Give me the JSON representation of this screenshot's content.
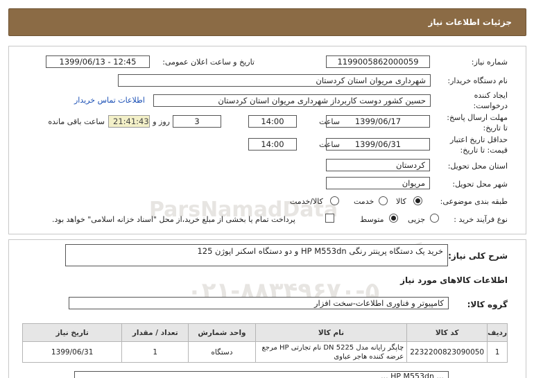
{
  "header": {
    "title": "جزئیات اطلاعات نیاز"
  },
  "labels": {
    "need_number": "شماره نیاز:",
    "announce_datetime": "تاریخ و ساعت اعلان عمومی:",
    "buyer_org": "نام دستگاه خریدار:",
    "requester_line1": "ایجاد کننده",
    "requester_line2": "درخواست:",
    "buyer_contact": "اطلاعات تماس خریدار",
    "deadline_line1": "مهلت ارسال پاسخ:",
    "deadline_line2": "تا تاریخ:",
    "time": "ساعت",
    "days_and": "روز و",
    "remaining": "ساعت باقی مانده",
    "validity_line1": "حداقل تاریخ اعتبار",
    "validity_line2": "قیمت: تا تاریخ:",
    "province": "استان محل تحویل:",
    "city": "شهر محل تحویل:",
    "category": "طبقه بندی موضوعی:",
    "process": "نوع فرآیند خرید :",
    "description": "شرح کلی نیاز:",
    "goods_info": "اطلاعات کالاهای مورد نیاز",
    "goods_group": "گروه کالا:"
  },
  "fields": {
    "need_number": "1199005862000059",
    "announce_datetime": "1399/06/13 - 12:45",
    "buyer_org": "شهرداری مریوان استان کردستان",
    "requester": "حسین کشور دوست کاربرداز شهرداری مریوان استان کردستان",
    "deadline_date": "1399/06/17",
    "deadline_time": "14:00",
    "days": "3",
    "remaining_clock": "21:41:43",
    "validity_date": "1399/06/31",
    "validity_time": "14:00",
    "province": "کردستان",
    "city": "مریوان",
    "description": "خرید یک دستگاه پرینتر رنگی HP M553dn و دو دستگاه اسکنر اپوژن 125",
    "goods_group": "کامپیوتر و فناوری اطلاعات-سخت افزار"
  },
  "category_options": [
    {
      "label": "کالا",
      "selected": true
    },
    {
      "label": "خدمت",
      "selected": false
    },
    {
      "label": "کالا/خدمت",
      "selected": false
    }
  ],
  "process_options": [
    {
      "label": "جزیی",
      "selected": false
    },
    {
      "label": "متوسط",
      "selected": true
    }
  ],
  "payment_note": "پرداخت تمام یا بخشی از مبلغ خرید،از محل \"اسناد خزانه اسلامی\" خواهد بود.",
  "table": {
    "headers": [
      "ردیف",
      "کد کالا",
      "نام کالا",
      "واحد شمارش",
      "تعداد / مقدار",
      "تاریخ نیاز"
    ],
    "rows": [
      [
        "1",
        "2232200823090050",
        "چاپگر رایانه مدل DN 5225 نام تجارتی HP مرجع عرضه کننده هاجر عباوی",
        "دستگاه",
        "1",
        "1399/06/31"
      ]
    ]
  },
  "bottom_text": "... HP M553dn ..."
}
